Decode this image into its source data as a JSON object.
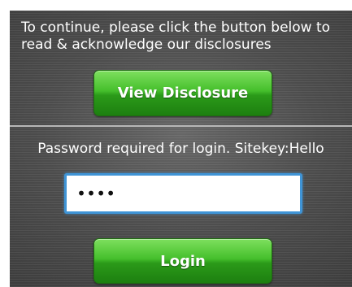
{
  "disclosure": {
    "intro_text": "To continue, please click the button below to read & acknowledge our disclosures",
    "button_label": "View Disclosure"
  },
  "login": {
    "password_label": "Password required for login. Sitekey:Hello",
    "password_value": "••••",
    "button_label": "Login"
  },
  "colors": {
    "button_green": "#2b9a19",
    "field_focus_border": "#3f94d6",
    "panel_background": "#4f4f4f"
  }
}
